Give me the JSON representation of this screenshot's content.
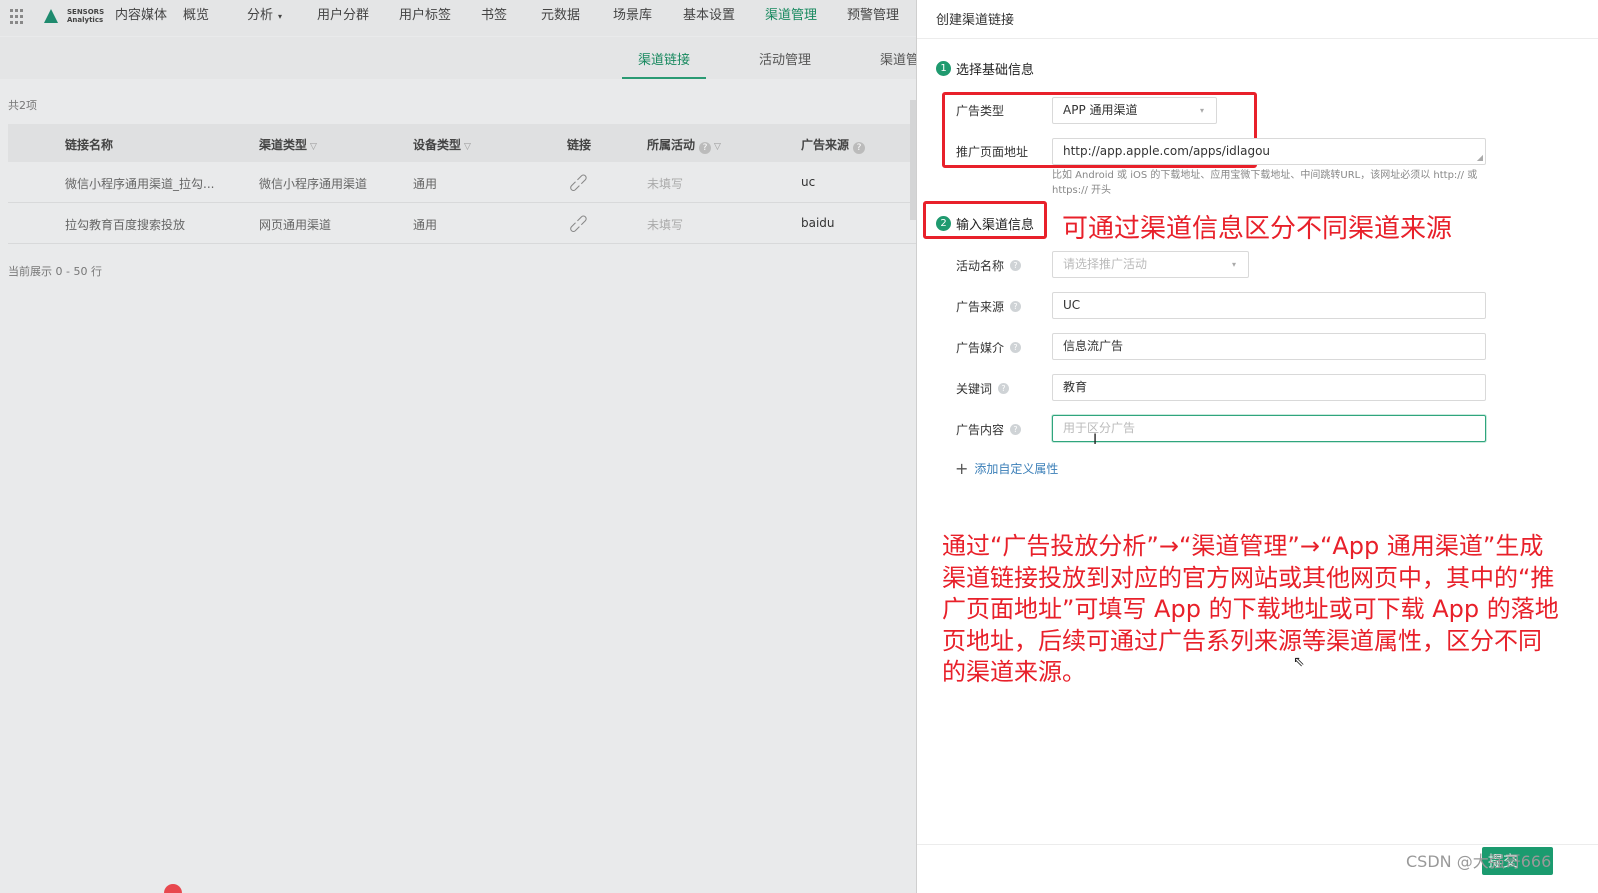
{
  "logo": {
    "line1": "SENSORS",
    "line2": "Analytics"
  },
  "nav": {
    "items": [
      {
        "label": "内容媒体",
        "caret": false,
        "active": false
      },
      {
        "label": "概览",
        "caret": false,
        "active": false
      },
      {
        "label": "分析",
        "caret": true,
        "active": false
      },
      {
        "label": "用户分群",
        "caret": false,
        "active": false
      },
      {
        "label": "用户标签",
        "caret": false,
        "active": false
      },
      {
        "label": "书签",
        "caret": false,
        "active": false
      },
      {
        "label": "元数据",
        "caret": false,
        "active": false
      },
      {
        "label": "场景库",
        "caret": false,
        "active": false
      },
      {
        "label": "基本设置",
        "caret": false,
        "active": false
      },
      {
        "label": "渠道管理",
        "caret": false,
        "active": true
      },
      {
        "label": "预警管理",
        "caret": false,
        "active": false
      }
    ],
    "caret_glyph": "▾"
  },
  "subtabs": {
    "tab1": "渠道链接",
    "tab2": "活动管理",
    "tab3": "渠道管"
  },
  "list": {
    "count": "共2项",
    "headers": {
      "name": "链接名称",
      "channel_type": "渠道类型",
      "device_type": "设备类型",
      "link": "链接",
      "activity": "所属活动",
      "ad_source": "广告来源"
    },
    "rows": [
      {
        "name": "微信小程序通用渠道_拉勾...",
        "channel_type": "微信小程序通用渠道",
        "device_type": "通用",
        "activity": "未填写",
        "source": "uc"
      },
      {
        "name": "拉勾教育百度搜索投放",
        "channel_type": "网页通用渠道",
        "device_type": "通用",
        "activity": "未填写",
        "source": "baidu"
      }
    ],
    "footer": "当前展示 0 - 50 行"
  },
  "drawer": {
    "title": "创建渠道链接",
    "section1": {
      "step": "1",
      "title": "选择基础信息"
    },
    "ad_type": {
      "label": "广告类型",
      "value": "APP 通用渠道"
    },
    "promo_url": {
      "label": "推广页面地址",
      "value": "http://app.apple.com/apps/idlagou",
      "hint": "比如 Android 或 iOS 的下载地址、应用宝微下载地址、中间跳转URL，该网址必须以 http:// 或 https:// 开头"
    },
    "section2": {
      "step": "2",
      "title": "输入渠道信息"
    },
    "activity_name": {
      "label": "活动名称",
      "placeholder": "请选择推广活动"
    },
    "ad_source": {
      "label": "广告来源",
      "value": "UC"
    },
    "ad_medium": {
      "label": "广告媒介",
      "value": "信息流广告"
    },
    "keyword": {
      "label": "关键词",
      "value": "教育"
    },
    "ad_content": {
      "label": "广告内容",
      "placeholder": "用于区分广告"
    },
    "add_attr": "添加自定义属性"
  },
  "annotations": {
    "small": "可通过渠道信息区分不同渠道来源",
    "big": "通过“广告投放分析”→“渠道管理”→“App 通用渠道”生成渠道链接投放到对应的官方网站或其他网页中，其中的“推广页面地址”可填写 App 的下载地址或可下载 App 的落地页地址，后续可通过广告系列来源等渠道属性，区分不同的渠道来源。"
  },
  "watermark": "CSDN @大强哥666",
  "footer_button": "提交"
}
